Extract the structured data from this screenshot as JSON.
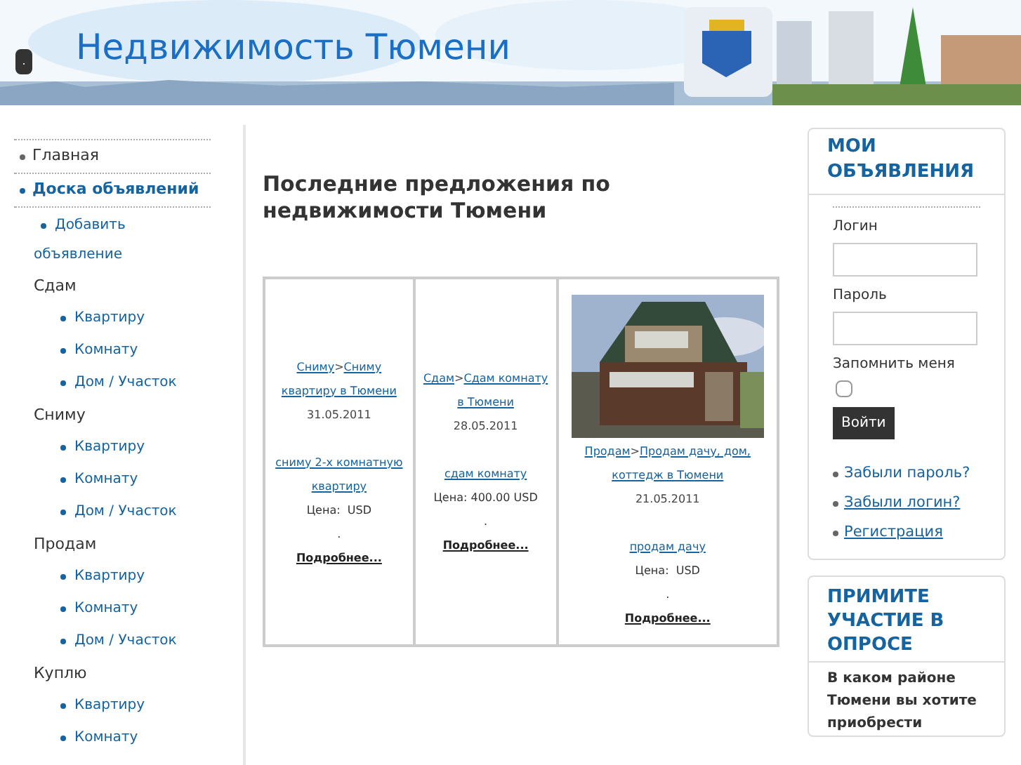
{
  "header": {
    "title": "Недвижимость Тюмени",
    "button": "."
  },
  "sidebar": {
    "items": [
      {
        "label": "Главная",
        "selected": false
      },
      {
        "label": "Доска объявлений",
        "selected": true,
        "children": [
          {
            "kind": "link",
            "label": "Добавить объявление"
          },
          {
            "kind": "group",
            "label": "Сдам",
            "children": [
              {
                "label": "Квартиру"
              },
              {
                "label": "Комнату"
              },
              {
                "label": "Дом / Участок"
              }
            ]
          },
          {
            "kind": "group",
            "label": "Сниму",
            "children": [
              {
                "label": "Квартиру"
              },
              {
                "label": "Комнату"
              },
              {
                "label": "Дом / Участок"
              }
            ]
          },
          {
            "kind": "group",
            "label": "Продам",
            "children": [
              {
                "label": "Квартиру"
              },
              {
                "label": "Комнату"
              },
              {
                "label": "Дом / Участок"
              }
            ]
          },
          {
            "kind": "group",
            "label": "Куплю",
            "children": [
              {
                "label": "Квартиру"
              },
              {
                "label": "Комнату"
              }
            ]
          }
        ]
      }
    ]
  },
  "content": {
    "heading": "Последние предложения по недвижимости Тюмени",
    "listings": [
      {
        "category": "Сниму",
        "separator": ">",
        "subcategory": "Сниму квартиру в Тюмени",
        "date": "31.05.2011",
        "title": "сниму 2-х комнатную квартиру",
        "price": "Цена:  USD",
        "dot": ".",
        "more": "Подробнее..."
      },
      {
        "category": "Сдам",
        "separator": ">",
        "subcategory": "Сдам комнату в Тюмени",
        "date": "28.05.2011",
        "title": "сдам комнату",
        "price": "Цена: 400.00 USD",
        "dot": ".",
        "more": "Подробнее..."
      },
      {
        "kind": "picture",
        "category": "Продам",
        "separator": ">",
        "subcategory": "Продам дачу, дом, коттедж в Тюмени",
        "date": "21.05.2011",
        "title": "продам дачу",
        "price": "Цена:  USD",
        "dot": ".",
        "more": "Подробнее..."
      }
    ]
  },
  "login": {
    "title": "МОИ ОБЪЯВЛЕНИЯ",
    "login_label": "Логин",
    "password_label": "Пароль",
    "remember_label": "Запомнить меня",
    "remember": false,
    "submit": "Войти",
    "links": [
      "Забыли пароль?",
      "Забыли логин?",
      "Регистрация"
    ]
  },
  "poll": {
    "title": "ПРИМИТЕ УЧАСТИЕ В ОПРОСЕ",
    "question": "В каком районе Тюмени вы хотите приобрести"
  }
}
